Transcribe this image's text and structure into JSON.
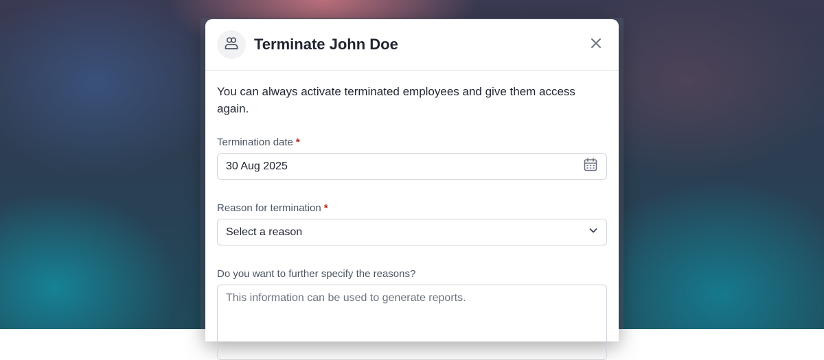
{
  "modal": {
    "title": "Terminate John Doe",
    "intro": "You can always activate terminated employees and give them access again."
  },
  "fields": {
    "termination_date": {
      "label": "Termination date",
      "required_mark": "*",
      "value": "30 Aug 2025"
    },
    "reason": {
      "label": "Reason for termination",
      "required_mark": "*",
      "value": "Select a reason"
    },
    "details": {
      "label": "Do you want to further specify the reasons?",
      "placeholder": "This information can be used to generate reports."
    }
  },
  "icons": {
    "avatar": "users-icon",
    "close": "close-icon",
    "date": "calendar-icon",
    "select": "chevron-down-icon"
  },
  "colors": {
    "required": "#b42318",
    "title": "#1f2430",
    "label": "#4b5563",
    "border": "#d1d5db"
  }
}
